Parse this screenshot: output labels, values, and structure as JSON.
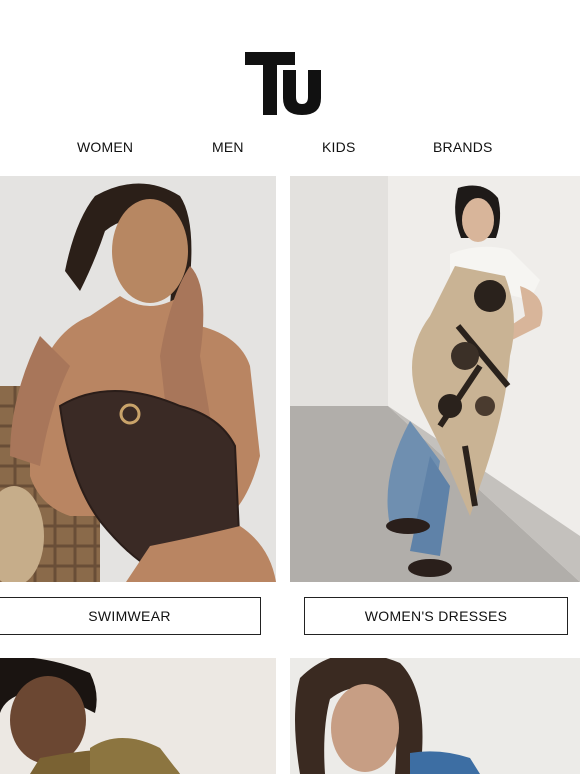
{
  "brand": {
    "logo_text": "Tu"
  },
  "nav": {
    "items": [
      {
        "label": "WOMEN"
      },
      {
        "label": "MEN"
      },
      {
        "label": "KIDS"
      },
      {
        "label": "BRANDS"
      }
    ]
  },
  "categories": [
    {
      "label": "SWIMWEAR",
      "image": "woman-swimwear-photo"
    },
    {
      "label": "WOMEN'S DRESSES",
      "image": "woman-dress-photo"
    }
  ],
  "teasers": [
    {
      "image": "woman-olive-jacket-photo"
    },
    {
      "image": "woman-denim-jacket-photo"
    }
  ]
}
